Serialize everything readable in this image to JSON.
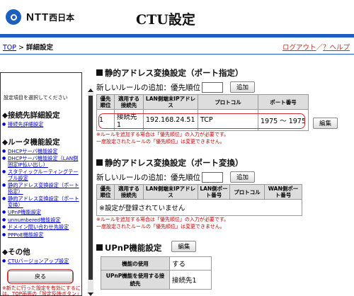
{
  "header": {
    "logo_text": "NTT",
    "logo_sub": "西日本",
    "page_title": "CTU設定"
  },
  "breadcrumb": {
    "top": "TOP",
    "separator": " > ",
    "current": "詳細設定"
  },
  "toplinks": {
    "logout": "ログアウト",
    "separator": "／",
    "help": "？ヘルプ"
  },
  "sidebar": {
    "hint": "設定項目を選択してください",
    "sections": [
      {
        "title": "◆接続先詳細設定",
        "items": [
          "接続先詳細設定"
        ]
      },
      {
        "title": "◆ルータ機能設定",
        "items": [
          "DHCPサーバ機能設定",
          "DHCPサーバ機能設定（LAN側固定IP払い出し）",
          "スタティックルーティングテーブル設定",
          "静的アドレス変換設定（ポート指定）",
          "静的アドレス変換設定（ポート変換）",
          "UPnP機能設定",
          "unnumbered機能設定",
          "ドメイン問い合わせ先設定",
          "PPPoE機能設定"
        ]
      },
      {
        "title": "◆その他",
        "items": [
          "CTUバージョンアップ設定"
        ]
      }
    ],
    "back_button": "戻る",
    "note": "※新たに行った設定を有効にするには、TOP画面の「設定反映ボタン」をクリック"
  },
  "section1": {
    "title": "静的アドレス変換設定（ポート指定）",
    "add_label": "新しいルールの追加：優先順位",
    "add_button": "追加",
    "headers": [
      "優先順位",
      "適用する接続先",
      "LAN側端末IPアドレス",
      "プロトコル",
      "ポート番号"
    ],
    "rows": [
      {
        "priority": "1",
        "conn": "接続先1",
        "ip": "192.168.24.51",
        "proto": "TCP",
        "port": "1975 〜 1975",
        "edit": "編集"
      }
    ],
    "warn1": "※ルールを追加する場合は「優先順位」の入力が必要です。",
    "warn2": "一度設定されたルールの「優先順位」は変更できません。"
  },
  "section2": {
    "title": "静的アドレス変換設定（ポート変換）",
    "add_label": "新しいルールの追加：優先順位",
    "add_button": "追加",
    "headers": [
      "優先順位",
      "適用する接続先",
      "LAN側端末IPアドレス",
      "LAN側ポート番号",
      "プロトコル",
      "WAN側ポート番号"
    ],
    "empty": "※設定が登録されていません",
    "warn1": "※ルールを追加する場合は「優先順位」の入力が必要です。",
    "warn2": "一度設定されたルールの「優先順位」は変更できません。"
  },
  "section3": {
    "title": "UPnP機能設定",
    "edit": "編集",
    "rows": [
      {
        "label": "機能の使用",
        "value": "する"
      },
      {
        "label": "UPnP機能を使用する接続先",
        "value": "接続先1"
      }
    ]
  }
}
